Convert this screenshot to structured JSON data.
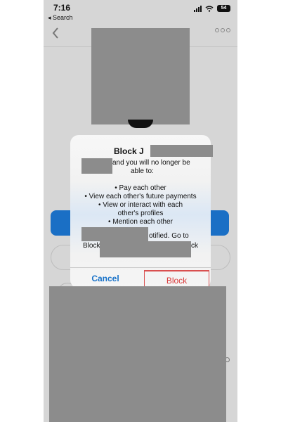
{
  "status_bar": {
    "time": "7:16",
    "back_app": "◂ Search",
    "battery": "54"
  },
  "dialog": {
    "title": "Block J",
    "text_line1": "and you will no longer be",
    "text_line2": "able to:",
    "bullets": [
      "• Pay each other",
      "• View each other's future payments",
      "• View or interact with each",
      "other's profiles",
      "• Mention each other"
    ],
    "footer_line1": "otified. Go to",
    "footer_line2_start": "Block",
    "footer_line2_end": "ck",
    "cancel_label": "Cancel",
    "block_label": "Block"
  },
  "colors": {
    "primary_blue": "#1a6fc5",
    "danger_red": "#d93a3a"
  }
}
